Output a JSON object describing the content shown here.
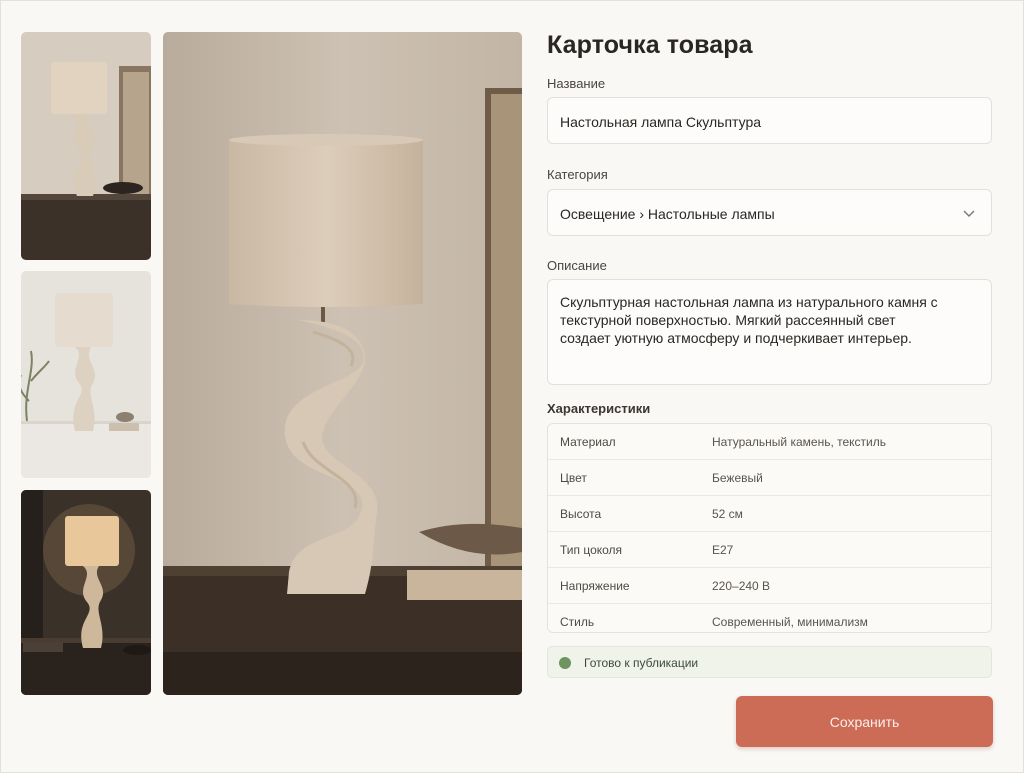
{
  "title": "Карточка товара",
  "fields": {
    "name": {
      "label": "Название",
      "value": "Настольная лампа Скульптура"
    },
    "category": {
      "label": "Категория",
      "value": "Освещение › Настольные лампы"
    },
    "description": {
      "label": "Описание",
      "value": "Скульптурная настольная лампа из натурального камня с текстурной поверхностью. Мягкий рассеянный свет создает уютную атмосферу и подчеркивает интерьер."
    }
  },
  "specs": {
    "heading": "Характеристики",
    "rows": [
      {
        "key": "Материал",
        "value": "Натуральный камень, текстиль"
      },
      {
        "key": "Цвет",
        "value": "Бежевый"
      },
      {
        "key": "Высота",
        "value": "52 см"
      },
      {
        "key": "Тип цоколя",
        "value": "E27"
      },
      {
        "key": "Напряжение",
        "value": "220–240 В"
      },
      {
        "key": "Стиль",
        "value": "Современный, минимализм"
      }
    ]
  },
  "status": {
    "text": "Готово к публикации",
    "color": "#6e9461"
  },
  "save_label": "Сохранить",
  "colors": {
    "accent": "#cc6c57",
    "background": "#f9f8f5"
  },
  "icons": {
    "category_dropdown": "chevron-down-icon",
    "status": "status-dot-icon"
  }
}
